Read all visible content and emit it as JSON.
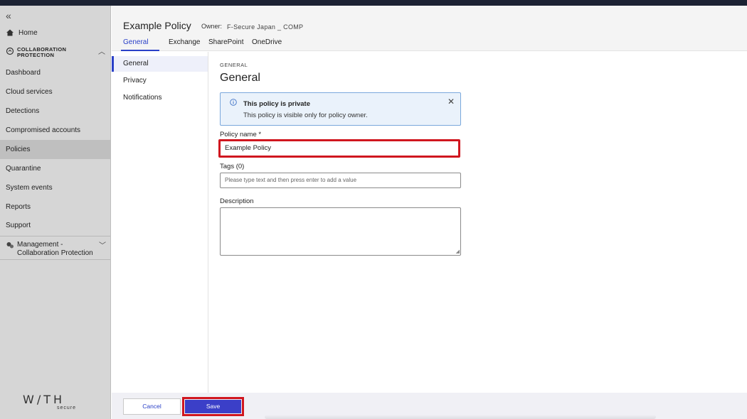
{
  "sidebar": {
    "collapse_glyph": "«",
    "home_label": "Home",
    "section_label": "COLLABORATION PROTECTION",
    "items": [
      {
        "label": "Dashboard"
      },
      {
        "label": "Cloud services"
      },
      {
        "label": "Detections"
      },
      {
        "label": "Compromised accounts"
      },
      {
        "label": "Policies"
      },
      {
        "label": "Quarantine"
      },
      {
        "label": "System events"
      },
      {
        "label": "Reports"
      },
      {
        "label": "Support"
      }
    ],
    "active_item": "Policies",
    "management_line1": "Management -",
    "management_line2": "Collaboration Protection",
    "logo_text": "W/TH",
    "logo_sub": "secure"
  },
  "header": {
    "title": "Example Policy",
    "owner_label": "Owner:",
    "owner_value": "F-Secure Japan _ COMP",
    "tabs": [
      {
        "label": "General"
      },
      {
        "label": "Exchange"
      },
      {
        "label": "SharePoint"
      },
      {
        "label": "OneDrive"
      }
    ],
    "active_tab": "General"
  },
  "subnav": {
    "items": [
      {
        "label": "General"
      },
      {
        "label": "Privacy"
      },
      {
        "label": "Notifications"
      }
    ],
    "active_item": "General"
  },
  "main": {
    "eyebrow": "GENERAL",
    "heading": "General",
    "alert": {
      "title": "This policy is private",
      "body": "This policy is visible only for policy owner.",
      "close_glyph": "✕"
    },
    "policy_name_label": "Policy name *",
    "policy_name_value": "Example Policy",
    "tags_label": "Tags (0)",
    "tags_placeholder": "Please type text and then press enter to add a value",
    "description_label": "Description",
    "description_value": ""
  },
  "footer": {
    "cancel_label": "Cancel",
    "save_label": "Save"
  },
  "colors": {
    "accent": "#2a40c8",
    "save_button": "#3b3fc8",
    "highlight": "#d0161f",
    "alert_bg": "#eaf2fb",
    "sidebar_bg": "#d6d6d6"
  }
}
